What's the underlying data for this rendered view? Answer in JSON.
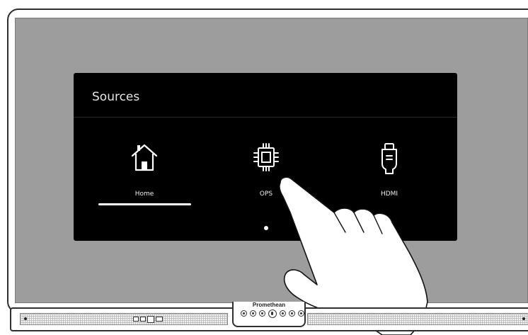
{
  "panel": {
    "title": "Sources"
  },
  "sources": [
    {
      "label": "Home",
      "icon": "home-icon",
      "selected": true
    },
    {
      "label": "OPS",
      "icon": "chip-icon",
      "selected": false
    },
    {
      "label": "HDMI",
      "icon": "hdmi-icon",
      "selected": false
    }
  ],
  "pagination": {
    "current_page": 1,
    "total_pages": 1
  },
  "device": {
    "brand": "Promethean"
  },
  "colors": {
    "screen_background": "#9d9d9d",
    "panel_background": "#000000",
    "selection_indicator": "#ffffff"
  }
}
